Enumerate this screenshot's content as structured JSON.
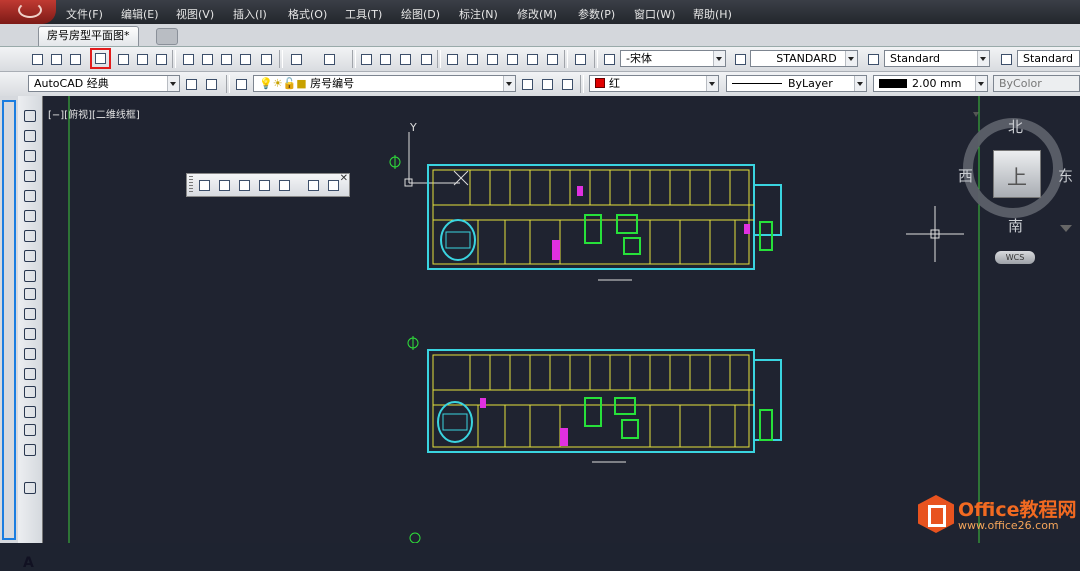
{
  "menubar": {
    "items": [
      "文件(F)",
      "编辑(E)",
      "视图(V)",
      "插入(I)",
      "格式(O)",
      "工具(T)",
      "绘图(D)",
      "标注(N)",
      "修改(M)",
      "参数(P)",
      "窗口(W)",
      "帮助(H)"
    ]
  },
  "tabs": {
    "active": "房号房型平面图*"
  },
  "toolbar1": {
    "text_style_font": "-宋体",
    "text_style": "STANDARD",
    "dim_style": "Standard",
    "table_style": "Standard"
  },
  "toolbar2": {
    "workspace": "AutoCAD 经典",
    "layer": "房号编号",
    "color": "红",
    "color_swatch": "#e00000",
    "linetype": "ByLayer",
    "lineweight": "2.00 mm",
    "plotstyle": "ByColor"
  },
  "viewport": {
    "label": "[−][俯视][二维线框]",
    "ucs_y": "Y"
  },
  "viewcube": {
    "north": "北",
    "south": "南",
    "east": "东",
    "west": "西",
    "top_face": "上",
    "wcs": "WCS"
  },
  "colors": {
    "walls": "#e6e23c",
    "cyan": "#3ad4e0",
    "green": "#27e03a",
    "magenta": "#e030e0",
    "crosshair": "#e0e0e0",
    "accent_red": "#e21b1b"
  },
  "watermark": {
    "title": "Office教程网",
    "url": "www.office26.com"
  }
}
